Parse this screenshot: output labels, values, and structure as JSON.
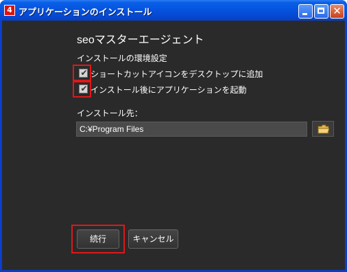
{
  "window": {
    "title": "アプリケーションのインストール",
    "icon_glyph": "4",
    "close_glyph": "✕"
  },
  "installer": {
    "app_name": "seoマスターエージェント",
    "settings_label": "インストールの環境設定",
    "options": [
      {
        "label": "ショートカットアイコンをデスクトップに追加",
        "checked": true
      },
      {
        "label": "インストール後にアプリケーションを起動",
        "checked": true
      }
    ],
    "check_glyph": "✔",
    "location_label": "インストール先：",
    "location_value": "C:¥Program Files"
  },
  "buttons": {
    "continue_label": "続行",
    "cancel_label": "キャンセル"
  },
  "colors": {
    "highlight": "#e01818",
    "client_bg": "#2a2a2a",
    "titlebar": "#0554e0"
  }
}
